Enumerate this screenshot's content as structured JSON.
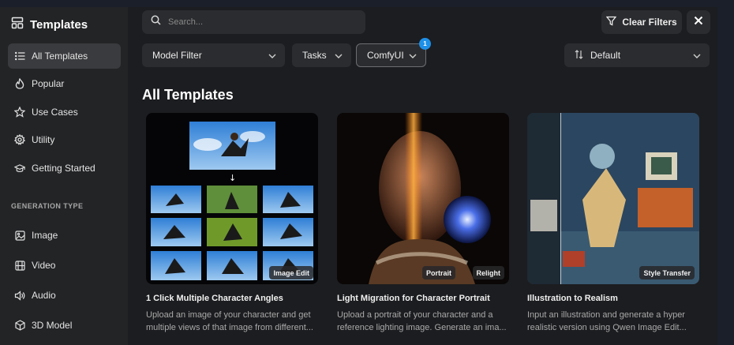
{
  "sidebar": {
    "title": "Templates",
    "items": [
      {
        "label": "All Templates",
        "icon": "list-icon"
      },
      {
        "label": "Popular",
        "icon": "flame-icon"
      },
      {
        "label": "Use Cases",
        "icon": "star-icon"
      },
      {
        "label": "Utility",
        "icon": "gear-icon"
      },
      {
        "label": "Getting Started",
        "icon": "graduation-cap-icon"
      }
    ],
    "section_label": "GENERATION TYPE",
    "gen_items": [
      {
        "label": "Image",
        "icon": "image-icon"
      },
      {
        "label": "Video",
        "icon": "film-icon"
      },
      {
        "label": "Audio",
        "icon": "speaker-icon"
      },
      {
        "label": "3D Model",
        "icon": "cube-icon"
      }
    ]
  },
  "search": {
    "placeholder": "Search..."
  },
  "toolbar": {
    "clear_filters": "Clear Filters"
  },
  "filters": {
    "model_filter": "Model Filter",
    "tasks": "Tasks",
    "comfyui": "ComfyUI",
    "comfyui_badge": "1",
    "sort": "Default"
  },
  "main": {
    "heading": "All Templates"
  },
  "cards": [
    {
      "title": "1 Click Multiple Character Angles",
      "desc": "Upload an image of your character and get multiple views of that image from different...",
      "tags": [
        "Image Edit"
      ]
    },
    {
      "title": "Light Migration for Character Portrait",
      "desc": "Upload a portrait of your character and a reference lighting image. Generate an ima...",
      "tags": [
        "Portrait",
        "Relight"
      ]
    },
    {
      "title": "Illustration to Realism",
      "desc": "Input an illustration and generate a hyper realistic version using Qwen Image Edit...",
      "tags": [
        "Style Transfer"
      ]
    }
  ],
  "colors": {
    "accent": "#1e90e8",
    "surface": "#2b2c2f",
    "sidebar": "#232426",
    "background": "#1c1d20"
  }
}
